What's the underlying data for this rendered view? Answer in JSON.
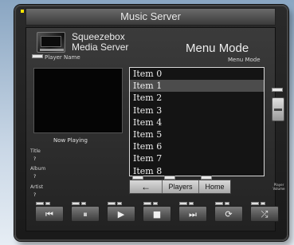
{
  "window": {
    "title": "Music Server"
  },
  "brand": {
    "line1": "Squeezebox",
    "line2": "Media Server"
  },
  "player": {
    "name_label": "Player Name"
  },
  "menu": {
    "title": "Menu Mode",
    "subtitle": "Menu Mode",
    "items": [
      "Item 0",
      "Item 1",
      "Item 2",
      "Item 3",
      "Item 4",
      "Item 5",
      "Item 6",
      "Item 7",
      "Item 8"
    ],
    "selected_index": 1
  },
  "now_playing": {
    "heading": "Now Playing",
    "title_label": "Title",
    "title_value": "?",
    "album_label": "Album",
    "album_value": "?",
    "artist_label": "Artist",
    "artist_value": "?"
  },
  "navigation": {
    "back_icon": "←",
    "players_label": "Players",
    "home_label": "Home"
  },
  "volume": {
    "label": "Player Volume"
  },
  "transport": {
    "prev_icon": "⏮",
    "pause_icon": "⏸",
    "play_icon": "▶",
    "stop_icon": "■",
    "next_icon": "⏭",
    "repeat_icon": "⟳",
    "shuffle_icon": "⤮"
  },
  "colors": {
    "accent": "#ffe400",
    "selected_row": "#4c4c4c"
  }
}
